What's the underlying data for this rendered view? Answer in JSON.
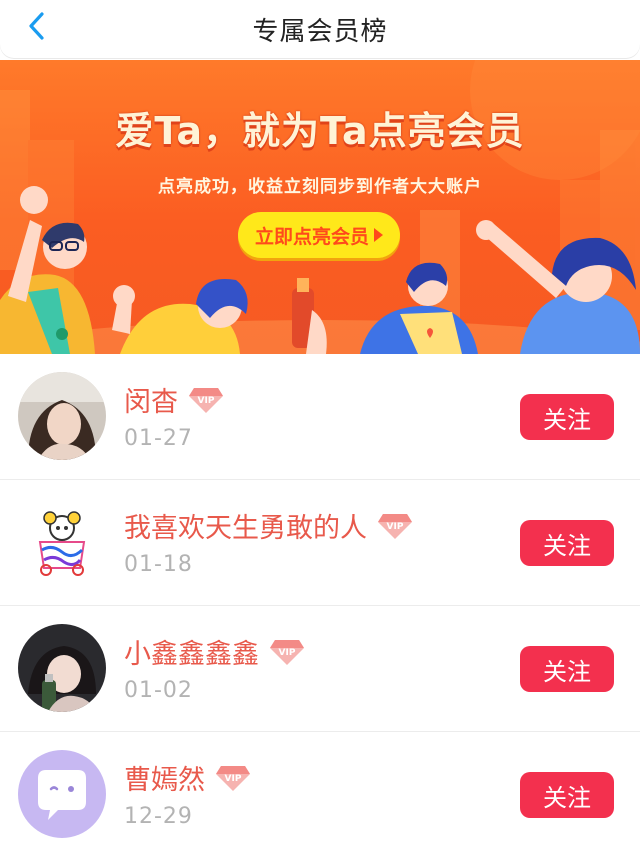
{
  "header": {
    "title": "专属会员榜",
    "back_icon": "chevron-left-icon"
  },
  "banner": {
    "headline": "爱Ta，就为Ta点亮会员",
    "subline": "点亮成功，收益立刻同步到作者大大账户",
    "cta_label": "立即点亮会员",
    "colors": {
      "background": "#fb5d22",
      "cta": "#ffe81a",
      "cta_text": "#ff4a1b"
    }
  },
  "members": [
    {
      "name": "闵杳",
      "date": "01-27",
      "follow_label": "关注",
      "avatar": "photo-avatar"
    },
    {
      "name": "我喜欢天生勇敢的人",
      "date": "01-18",
      "follow_label": "关注",
      "avatar": "drawing-avatar"
    },
    {
      "name": "小鑫鑫鑫鑫",
      "date": "01-02",
      "follow_label": "关注",
      "avatar": "photo-avatar"
    },
    {
      "name": "曹嫣然",
      "date": "12-29",
      "follow_label": "关注",
      "avatar": "default-chat-avatar"
    }
  ],
  "vip_badge": {
    "text": "VIP",
    "icon": "diamond-vip-icon"
  },
  "colors": {
    "name": "#e8594b",
    "date": "#b3b3b3",
    "follow_button": "#f3304e"
  }
}
